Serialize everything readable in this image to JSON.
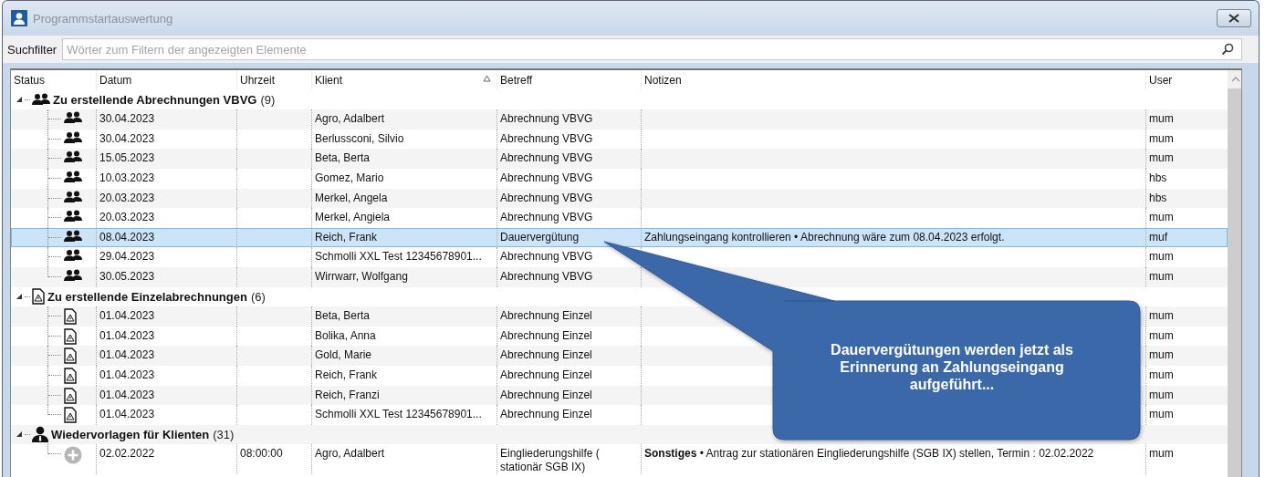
{
  "window": {
    "title": "Programmstartauswertung"
  },
  "search": {
    "label": "Suchfilter",
    "placeholder": "Wörter zum Filtern der angezeigten Elemente"
  },
  "table": {
    "columns": [
      {
        "label": "Status",
        "sorted": false
      },
      {
        "label": "Datum",
        "sorted": false
      },
      {
        "label": "Uhrzeit",
        "sorted": false
      },
      {
        "label": "Klient",
        "sorted": true
      },
      {
        "label": "Betreff",
        "sorted": false
      },
      {
        "label": "Notizen",
        "sorted": false
      },
      {
        "label": "User",
        "sorted": false
      }
    ],
    "groups": [
      {
        "kind": "pair",
        "label": "Zu erstellende Abrechnungen VBVG",
        "count": "(9)",
        "expanded": true,
        "rows": [
          {
            "kind": "pair",
            "date": "30.04.2023",
            "time": "",
            "client": "Agro, Adalbert",
            "subject": "Abrechnung VBVG",
            "notes": "",
            "user": "mum",
            "selected": false
          },
          {
            "kind": "pair",
            "date": "30.04.2023",
            "time": "",
            "client": "Berlussconi, Silvio",
            "subject": "Abrechnung VBVG",
            "notes": "",
            "user": "mum",
            "selected": false
          },
          {
            "kind": "pair",
            "date": "15.05.2023",
            "time": "",
            "client": "Beta, Berta",
            "subject": "Abrechnung VBVG",
            "notes": "",
            "user": "mum",
            "selected": false
          },
          {
            "kind": "pair",
            "date": "10.03.2023",
            "time": "",
            "client": "Gomez, Mario",
            "subject": "Abrechnung VBVG",
            "notes": "",
            "user": "hbs",
            "selected": false
          },
          {
            "kind": "pair",
            "date": "20.03.2023",
            "time": "",
            "client": "Merkel, Angela",
            "subject": "Abrechnung VBVG",
            "notes": "",
            "user": "hbs",
            "selected": false
          },
          {
            "kind": "pair",
            "date": "20.03.2023",
            "time": "",
            "client": "Merkel, Angiela",
            "subject": "Abrechnung VBVG",
            "notes": "",
            "user": "mum",
            "selected": false
          },
          {
            "kind": "pair",
            "date": "08.04.2023",
            "time": "",
            "client": "Reich, Frank",
            "subject": "Dauervergütung",
            "notes": "Zahlungseingang kontrollieren • Abrechnung wäre zum 08.04.2023 erfolgt.",
            "user": "muf",
            "selected": true
          },
          {
            "kind": "pair",
            "date": "29.04.2023",
            "time": "",
            "client": "Schmolli XXL Test 12345678901...",
            "subject": "Abrechnung VBVG",
            "notes": "",
            "user": "mum",
            "selected": false
          },
          {
            "kind": "pair",
            "date": "30.05.2023",
            "time": "",
            "client": "Wirrwarr, Wolfgang",
            "subject": "Abrechnung VBVG",
            "notes": "",
            "user": "mum",
            "selected": false
          }
        ]
      },
      {
        "kind": "document",
        "label": "Zu erstellende Einzelabrechnungen",
        "count": "(6)",
        "expanded": true,
        "rows": [
          {
            "kind": "document",
            "date": "01.04.2023",
            "time": "",
            "client": "Beta, Berta",
            "subject": "Abrechnung Einzel",
            "notes": "",
            "user": "mum",
            "selected": false
          },
          {
            "kind": "document",
            "date": "01.04.2023",
            "time": "",
            "client": "Bolika, Anna",
            "subject": "Abrechnung Einzel",
            "notes": "",
            "user": "mum",
            "selected": false
          },
          {
            "kind": "document",
            "date": "01.04.2023",
            "time": "",
            "client": "Gold, Marie",
            "subject": "Abrechnung Einzel",
            "notes": "",
            "user": "mum",
            "selected": false
          },
          {
            "kind": "document",
            "date": "01.04.2023",
            "time": "",
            "client": "Reich, Frank",
            "subject": "Abrechnung Einzel",
            "notes": "",
            "user": "mum",
            "selected": false
          },
          {
            "kind": "document",
            "date": "01.04.2023",
            "time": "",
            "client": "Reich, Franzi",
            "subject": "Abrechnung Einzel",
            "notes": "",
            "user": "mum",
            "selected": false
          },
          {
            "kind": "document",
            "date": "01.04.2023",
            "time": "",
            "client": "Schmolli XXL Test 12345678901...",
            "subject": "Abrechnung Einzel",
            "notes": "",
            "user": "mum",
            "selected": false
          }
        ]
      },
      {
        "kind": "person",
        "label": "Wiedervorlagen für Klienten",
        "count": "(31)",
        "expanded": true,
        "rows": [
          {
            "kind": "plus",
            "date": "02.02.2022",
            "time": "08:00:00",
            "client": "Agro, Adalbert",
            "subject": "Eingliederungshilfe ( stationär SGB IX)",
            "notes": "**Sonstiges** • Antrag zur stationären Eingliederungshilfe (SGB IX) stellen, Termin : 02.02.2022",
            "user": "mum",
            "selected": false
          }
        ]
      }
    ]
  },
  "callout": {
    "text": "Dauervergütungen werden jetzt als Erinnerung an Zahlungseingang aufgeführt..."
  }
}
